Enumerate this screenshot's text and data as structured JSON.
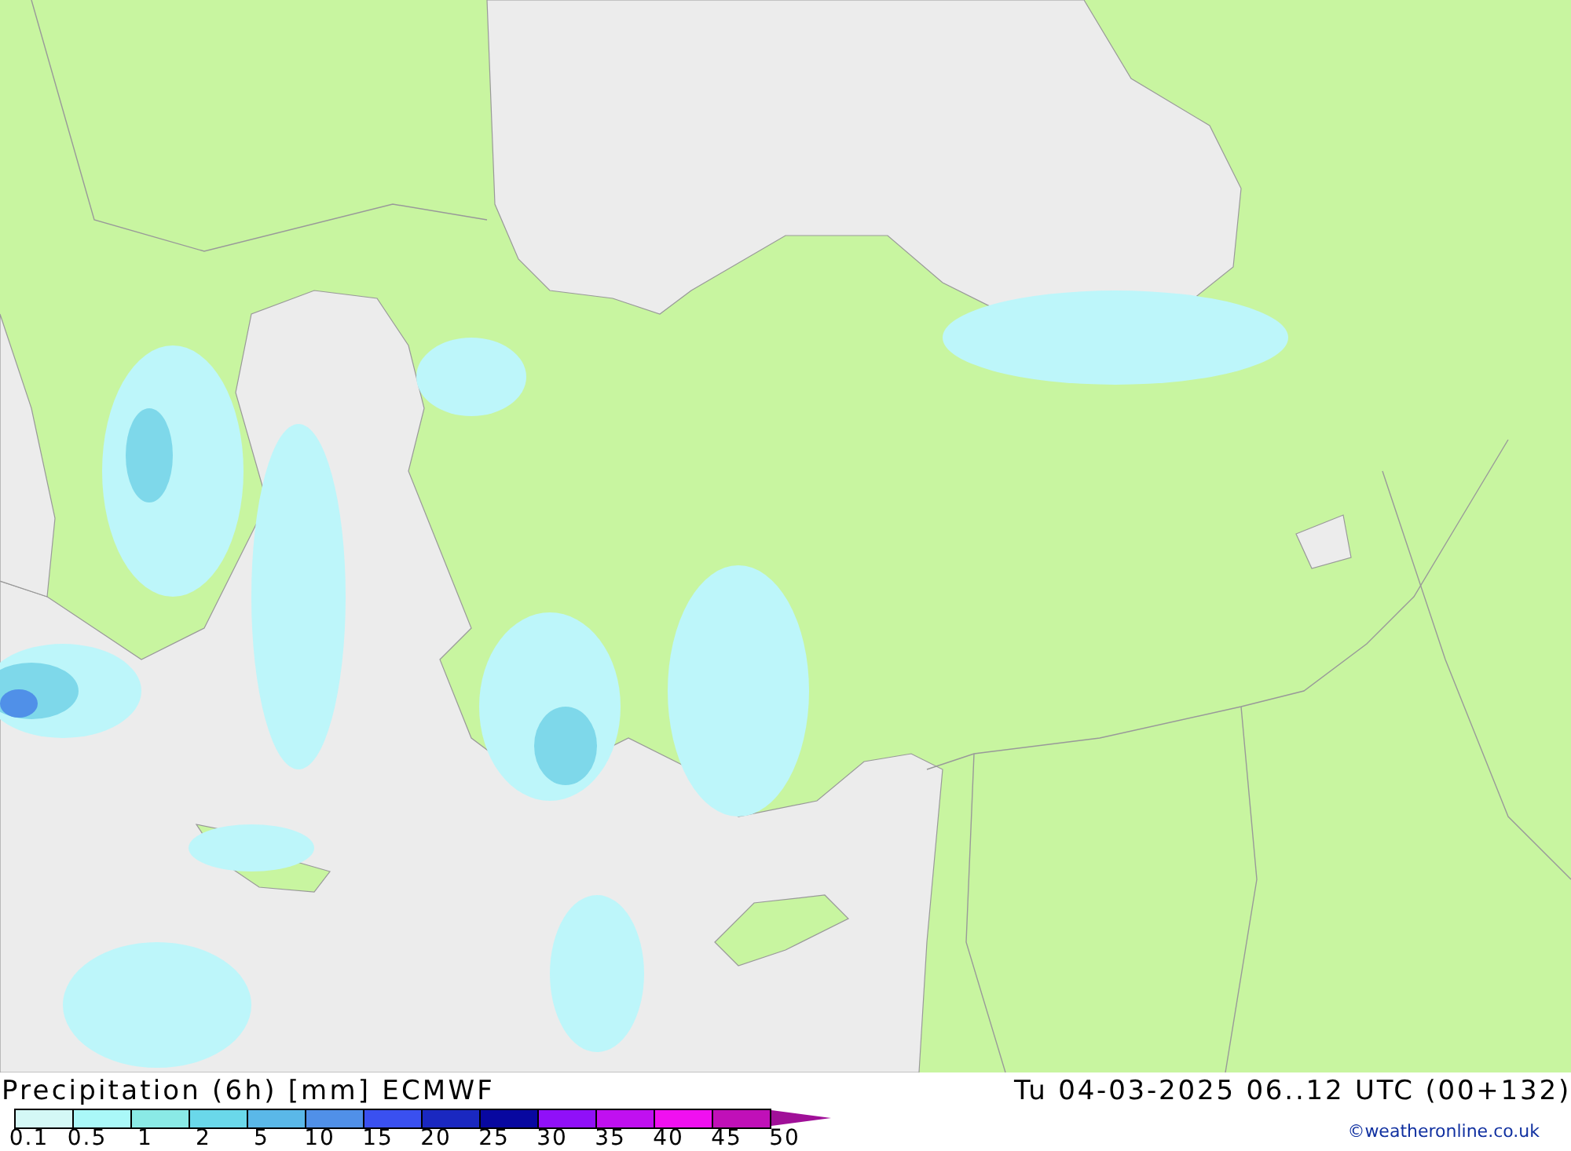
{
  "title": "Precipitation (6h) [mm] ECMWF",
  "valid_time": "Tu 04-03-2025 06..12 UTC (00+132)",
  "legend": [
    {
      "label": "0.1",
      "color": "#d4f8f6"
    },
    {
      "label": "0.5",
      "color": "#aaf8f8"
    },
    {
      "label": "1",
      "color": "#8aeae6"
    },
    {
      "label": "2",
      "color": "#6ad8ea"
    },
    {
      "label": "5",
      "color": "#5ab8e8"
    },
    {
      "label": "10",
      "color": "#5090e8"
    },
    {
      "label": "15",
      "color": "#3a50f0"
    },
    {
      "label": "20",
      "color": "#1a28c0"
    },
    {
      "label": "25",
      "color": "#0808a0"
    },
    {
      "label": "30",
      "color": "#9010f8"
    },
    {
      "label": "35",
      "color": "#c010f0"
    },
    {
      "label": "40",
      "color": "#f010f0"
    },
    {
      "label": "45",
      "color": "#c010b8"
    },
    {
      "label": "50",
      "color": "#a01098"
    }
  ],
  "credit": "©weatheronline.co.uk"
}
